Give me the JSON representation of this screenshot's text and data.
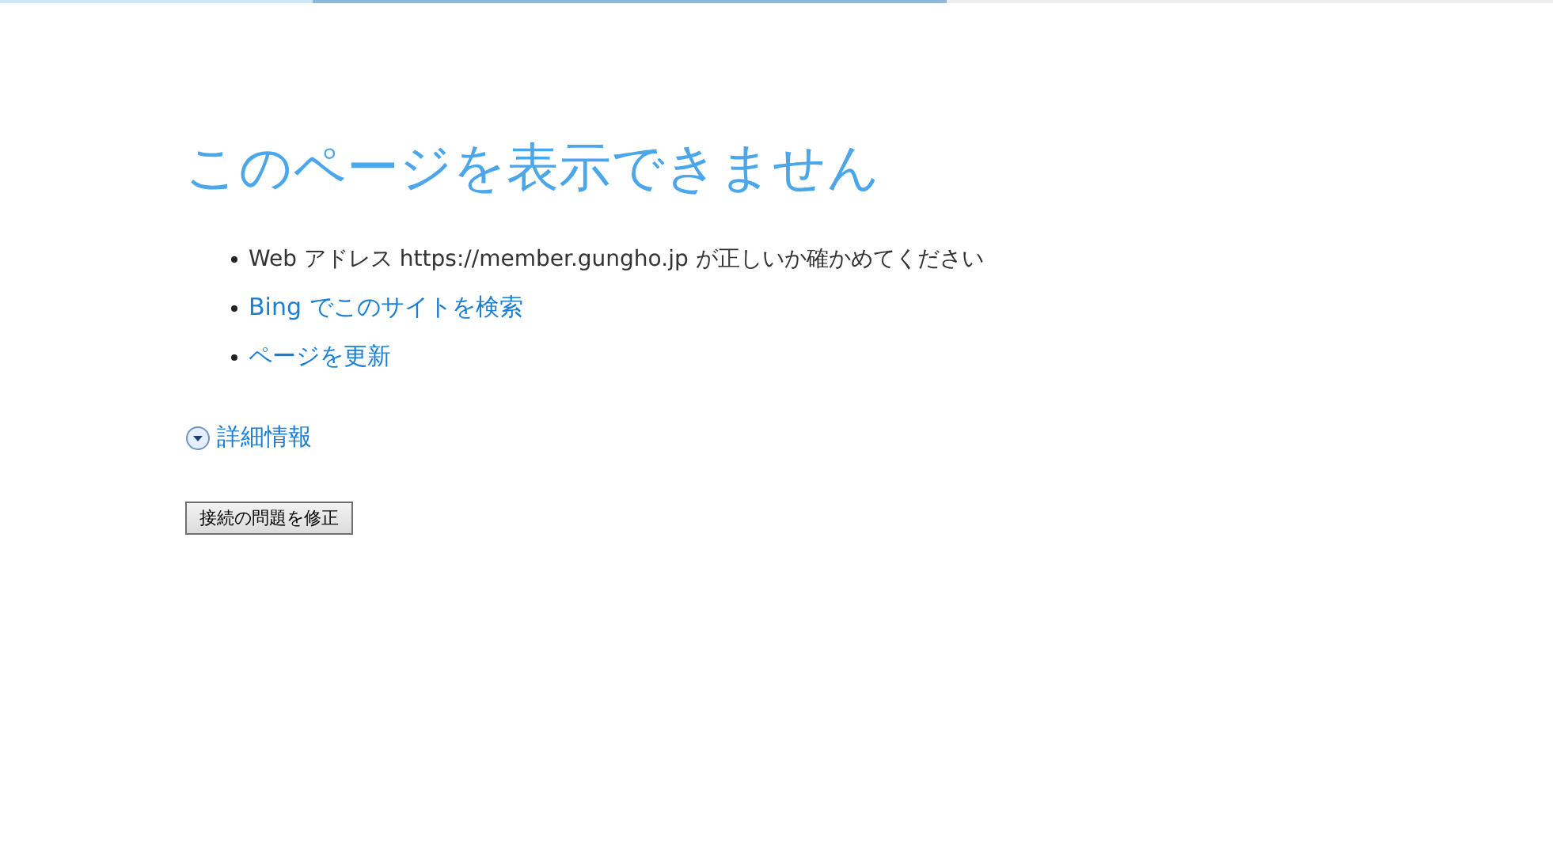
{
  "loading_bar": {
    "level": 0.61
  },
  "title": "このページを表示できません",
  "suggestions": [
    {
      "kind": "text",
      "text": "Web アドレス https://member.gungho.jp が正しいか確かめてください"
    },
    {
      "kind": "link",
      "text": "Bing でこのサイトを検索"
    },
    {
      "kind": "link",
      "text": "ページを更新"
    }
  ],
  "details": {
    "label": "詳細情報",
    "expanded": false
  },
  "fix_button": "接続の問題を修正"
}
